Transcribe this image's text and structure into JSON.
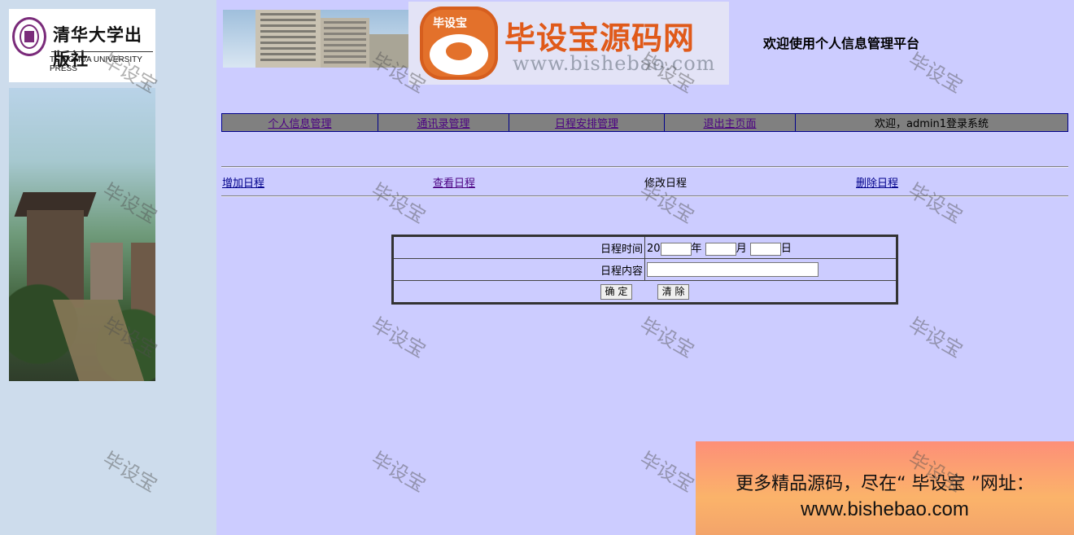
{
  "header": {
    "logo_cn": "清华大学出版社",
    "logo_en": "TSINGHUA UNIVERSITY PRESS",
    "welcome_title": "欢迎使用个人信息管理平台",
    "watermark_banner": {
      "title": "毕设宝源码网",
      "url": "www.bishebao.com",
      "icon_tag": "毕设宝"
    }
  },
  "nav": {
    "items": [
      {
        "label": "个人信息管理"
      },
      {
        "label": "通讯录管理"
      },
      {
        "label": "日程安排管理"
      },
      {
        "label": "退出主页面"
      }
    ],
    "user_status": "欢迎，admin1登录系统"
  },
  "subnav": {
    "add": "增加日程",
    "view": "查看日程",
    "edit": "修改日程",
    "delete": "删除日程"
  },
  "form": {
    "time_label": "日程时间",
    "year_prefix": "20",
    "year_unit": "年",
    "month_unit": "月",
    "day_unit": "日",
    "content_label": "日程内容",
    "year_value": "",
    "month_value": "",
    "day_value": "",
    "content_value": "",
    "confirm": "确 定",
    "clear": "清 除"
  },
  "watermark_text": "毕设宝",
  "ad": {
    "line1": "更多精品源码，尽在“ 毕设宝 ”网址：",
    "line2": "www.bishebao.com"
  }
}
